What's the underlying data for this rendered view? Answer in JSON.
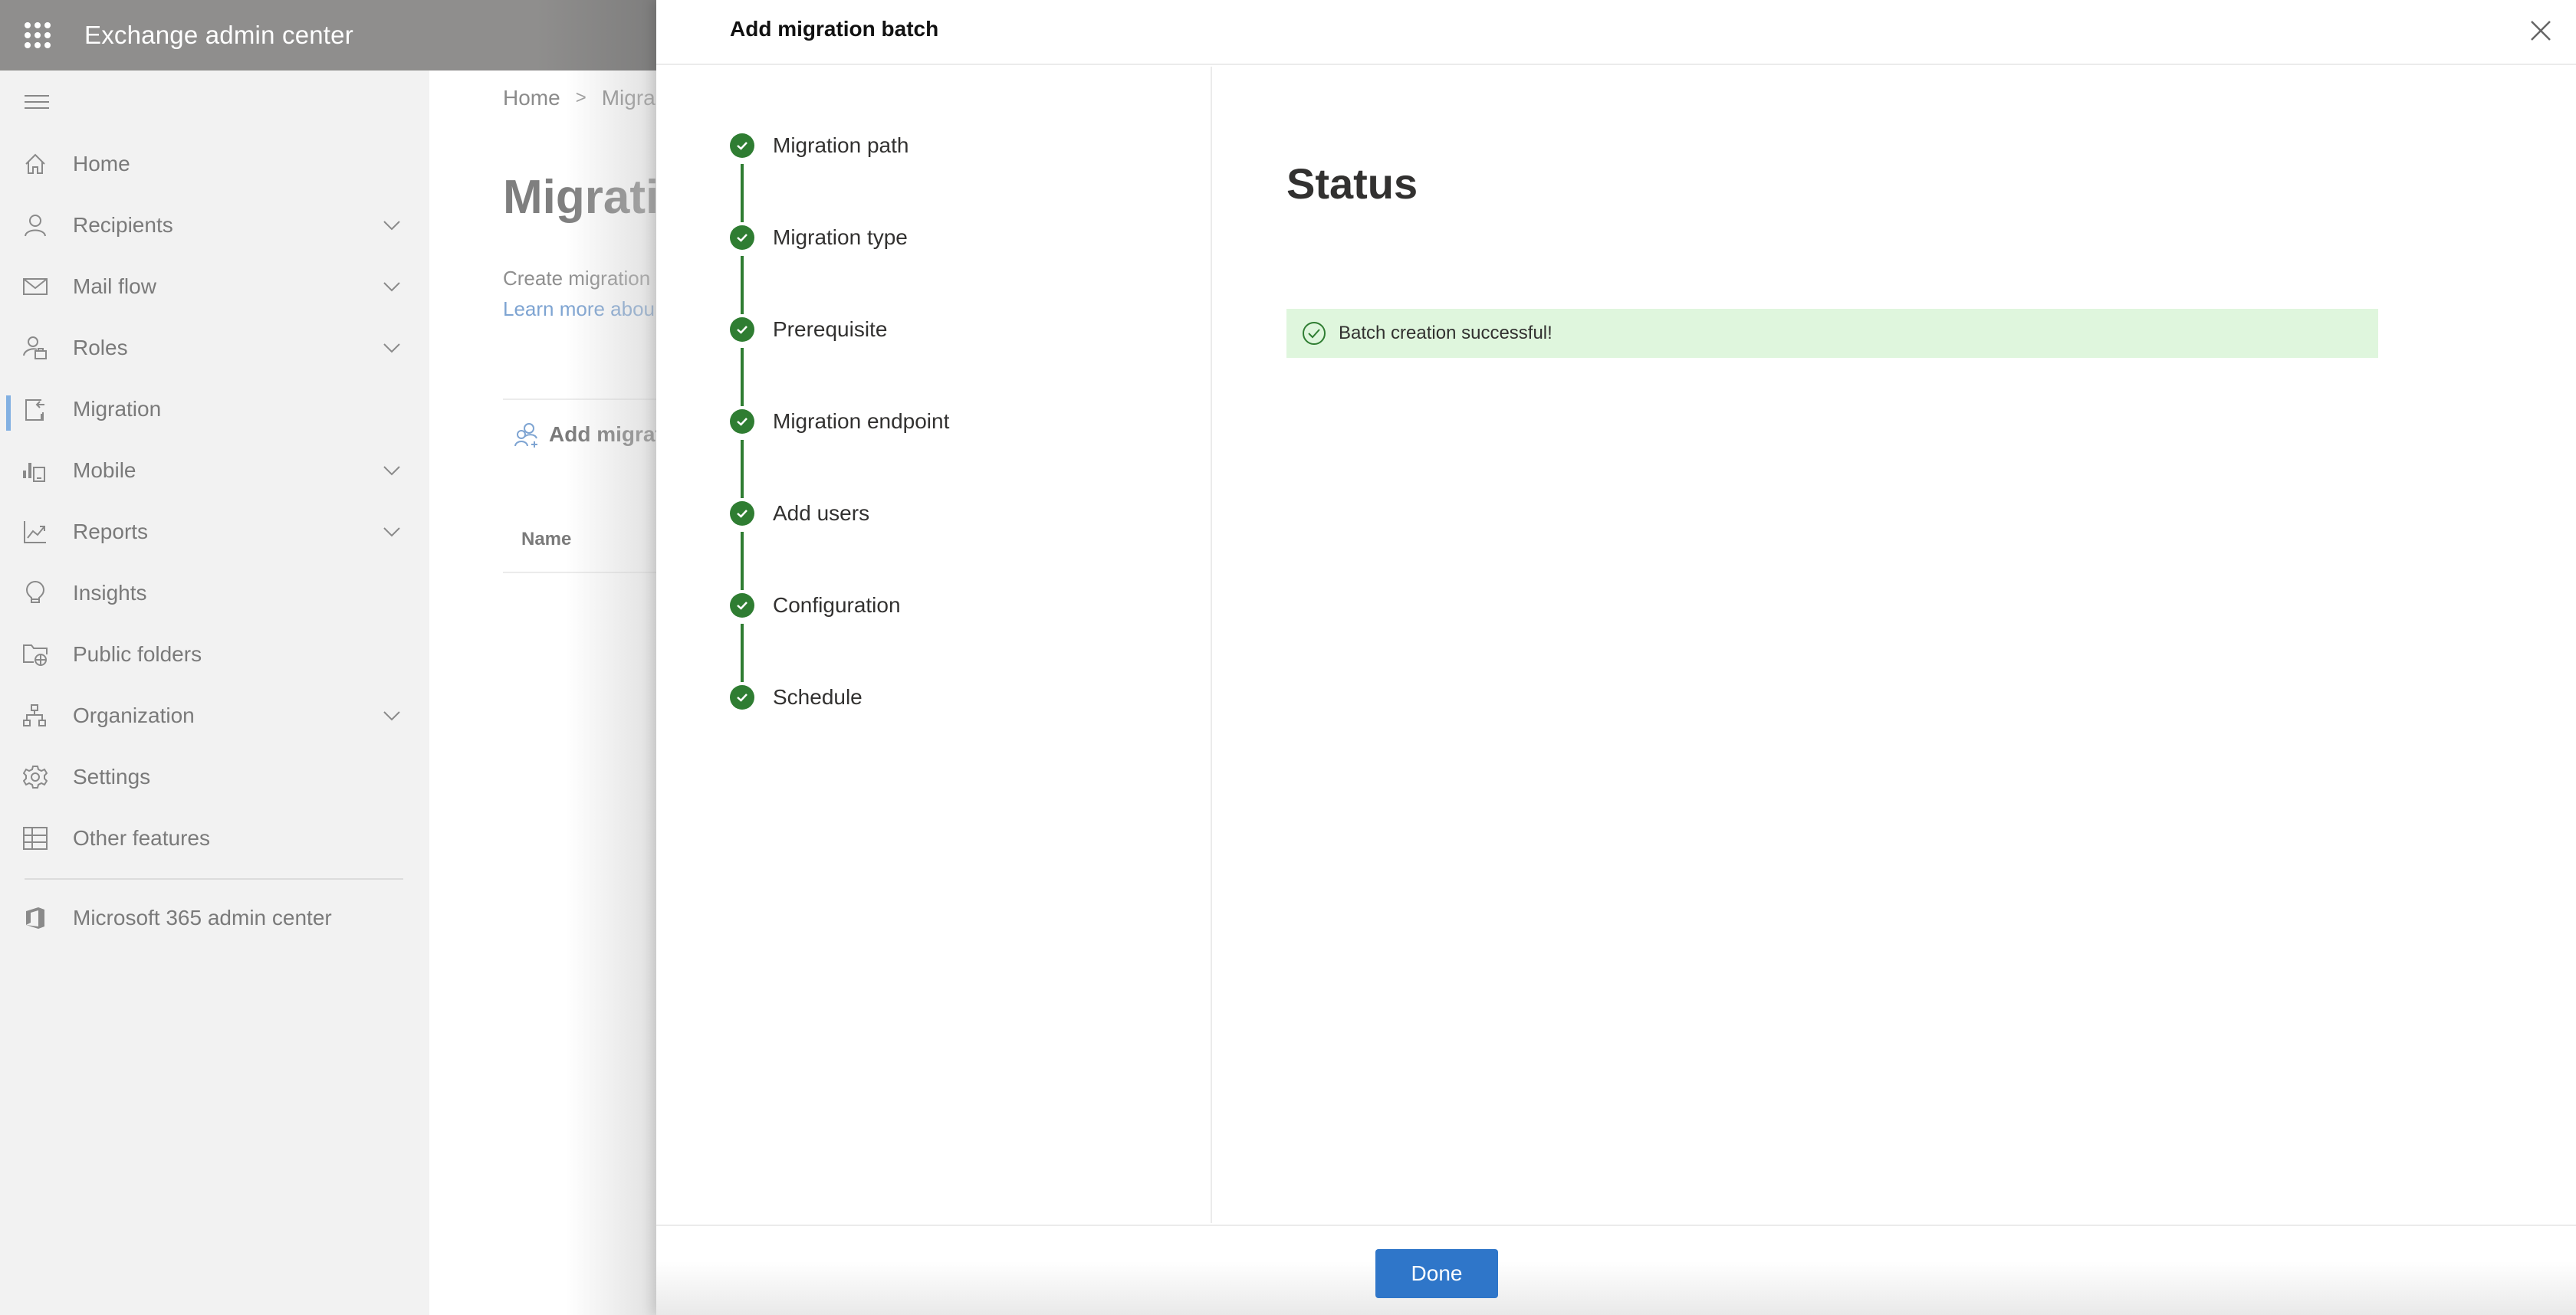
{
  "app": {
    "title": "Exchange admin center"
  },
  "sidebar": {
    "items": [
      {
        "label": "Home",
        "icon": "home-icon",
        "expandable": false
      },
      {
        "label": "Recipients",
        "icon": "person-icon",
        "expandable": true
      },
      {
        "label": "Mail flow",
        "icon": "mail-icon",
        "expandable": true
      },
      {
        "label": "Roles",
        "icon": "roles-icon",
        "expandable": true
      },
      {
        "label": "Migration",
        "icon": "migration-icon",
        "expandable": false,
        "active": true
      },
      {
        "label": "Mobile",
        "icon": "mobile-icon",
        "expandable": true
      },
      {
        "label": "Reports",
        "icon": "chart-icon",
        "expandable": true
      },
      {
        "label": "Insights",
        "icon": "lightbulb-icon",
        "expandable": false
      },
      {
        "label": "Public folders",
        "icon": "folder-globe-icon",
        "expandable": false
      },
      {
        "label": "Organization",
        "icon": "org-chart-icon",
        "expandable": true
      },
      {
        "label": "Settings",
        "icon": "gear-icon",
        "expandable": false
      },
      {
        "label": "Other features",
        "icon": "table-icon",
        "expandable": false
      }
    ],
    "footer_item": {
      "label": "Microsoft 365 admin center",
      "icon": "office-icon"
    }
  },
  "main": {
    "breadcrumb": [
      "Home",
      "Migra"
    ],
    "page_title": "Migratio",
    "description": "Create migration",
    "learn_more": "Learn more abou",
    "command_add": "Add migrat",
    "table_header_name": "Name"
  },
  "panel": {
    "title": "Add migration batch",
    "steps": [
      {
        "label": "Migration path",
        "status": "complete"
      },
      {
        "label": "Migration type",
        "status": "complete"
      },
      {
        "label": "Prerequisite",
        "status": "complete"
      },
      {
        "label": "Migration endpoint",
        "status": "complete"
      },
      {
        "label": "Add users",
        "status": "complete"
      },
      {
        "label": "Configuration",
        "status": "complete"
      },
      {
        "label": "Schedule",
        "status": "complete"
      }
    ],
    "status_heading": "Status",
    "message": "Batch creation successful!",
    "done_label": "Done"
  },
  "colors": {
    "accent": "#2f76c9",
    "success": "#2f7d32",
    "success_bg": "#dff6dd",
    "active_indicator": "#82b0e2"
  }
}
